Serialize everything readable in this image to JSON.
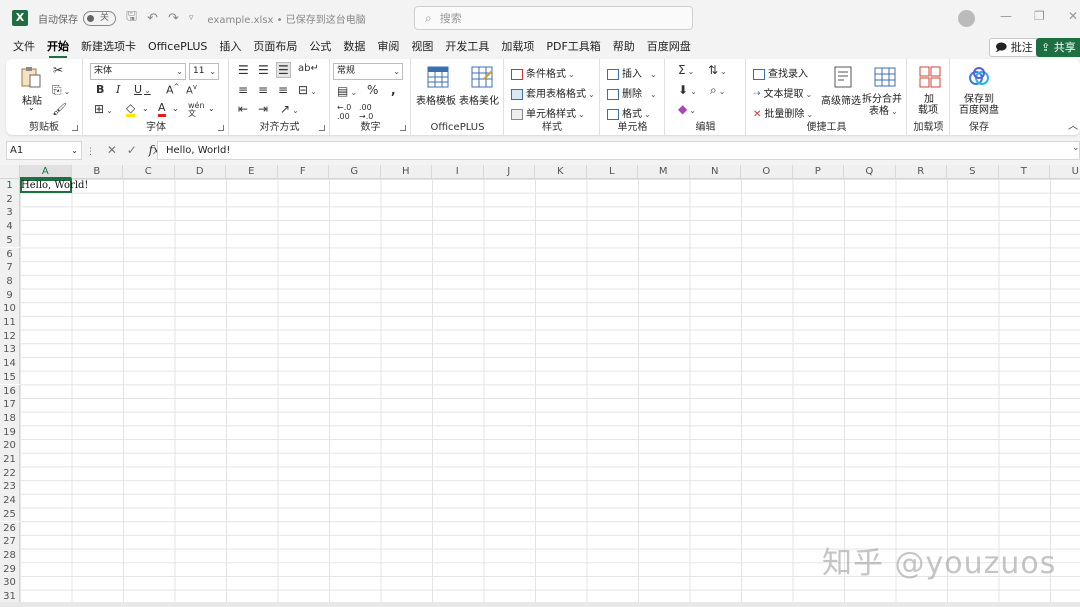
{
  "title_bar": {
    "app_icon": "X",
    "autosave_label": "自动保存",
    "autosave_state": "关",
    "filename": "example.xlsx • 已保存到这台电脑",
    "search_placeholder": "搜索"
  },
  "menu": {
    "tabs": [
      "文件",
      "开始",
      "新建选项卡",
      "OfficePLUS",
      "插入",
      "页面布局",
      "公式",
      "数据",
      "审阅",
      "视图",
      "开发工具",
      "加载项",
      "PDF工具箱",
      "帮助",
      "百度网盘"
    ],
    "active": "开始",
    "comment_label": "批注",
    "share_label": "共享"
  },
  "ribbon": {
    "clipboard": {
      "label": "剪贴板",
      "paste": "粘贴"
    },
    "font": {
      "label": "字体",
      "font_name": "宋体",
      "font_size": "11"
    },
    "alignment": {
      "label": "对齐方式"
    },
    "number": {
      "label": "数字",
      "format": "常规"
    },
    "officeplus": {
      "label": "OfficePLUS",
      "template": "表格模板",
      "beautify": "表格美化"
    },
    "styles": {
      "label": "样式",
      "conditional": "条件格式",
      "table_format": "套用表格格式",
      "cell_styles": "单元格样式"
    },
    "cells": {
      "label": "单元格",
      "insert": "插入",
      "delete": "删除",
      "format": "格式"
    },
    "editing": {
      "label": "编辑"
    },
    "quick_tools": {
      "label": "便捷工具",
      "lookup": "查找录入",
      "text_extract": "文本提取",
      "batch_delete": "批量删除",
      "advanced_filter": "高级筛选",
      "split_merge_1": "拆分合并",
      "split_merge_2": "表格"
    },
    "addins": {
      "label": "加载项",
      "btn_1": "加",
      "btn_2": "载项"
    },
    "save": {
      "label": "保存",
      "btn_1": "保存到",
      "btn_2": "百度网盘"
    }
  },
  "formula_bar": {
    "name_box": "A1",
    "fx": "fx",
    "content": "Hello, World!"
  },
  "sheet": {
    "columns": [
      "A",
      "B",
      "C",
      "D",
      "E",
      "F",
      "G",
      "H",
      "I",
      "J",
      "K",
      "L",
      "M",
      "N",
      "O",
      "P",
      "Q",
      "R",
      "S",
      "T",
      "U"
    ],
    "rows": [
      "1",
      "2",
      "3",
      "4",
      "5",
      "6",
      "7",
      "8",
      "9",
      "10",
      "11",
      "12",
      "13",
      "14",
      "15",
      "16",
      "17",
      "18",
      "19",
      "20",
      "21",
      "22",
      "23",
      "24",
      "25",
      "26",
      "27",
      "28",
      "29",
      "30",
      "31"
    ],
    "active_cell": "A1",
    "cell_a1": "Hello, World!"
  },
  "watermark": "知乎 @youzuos",
  "colors": {
    "accent": "#1d6f42"
  }
}
